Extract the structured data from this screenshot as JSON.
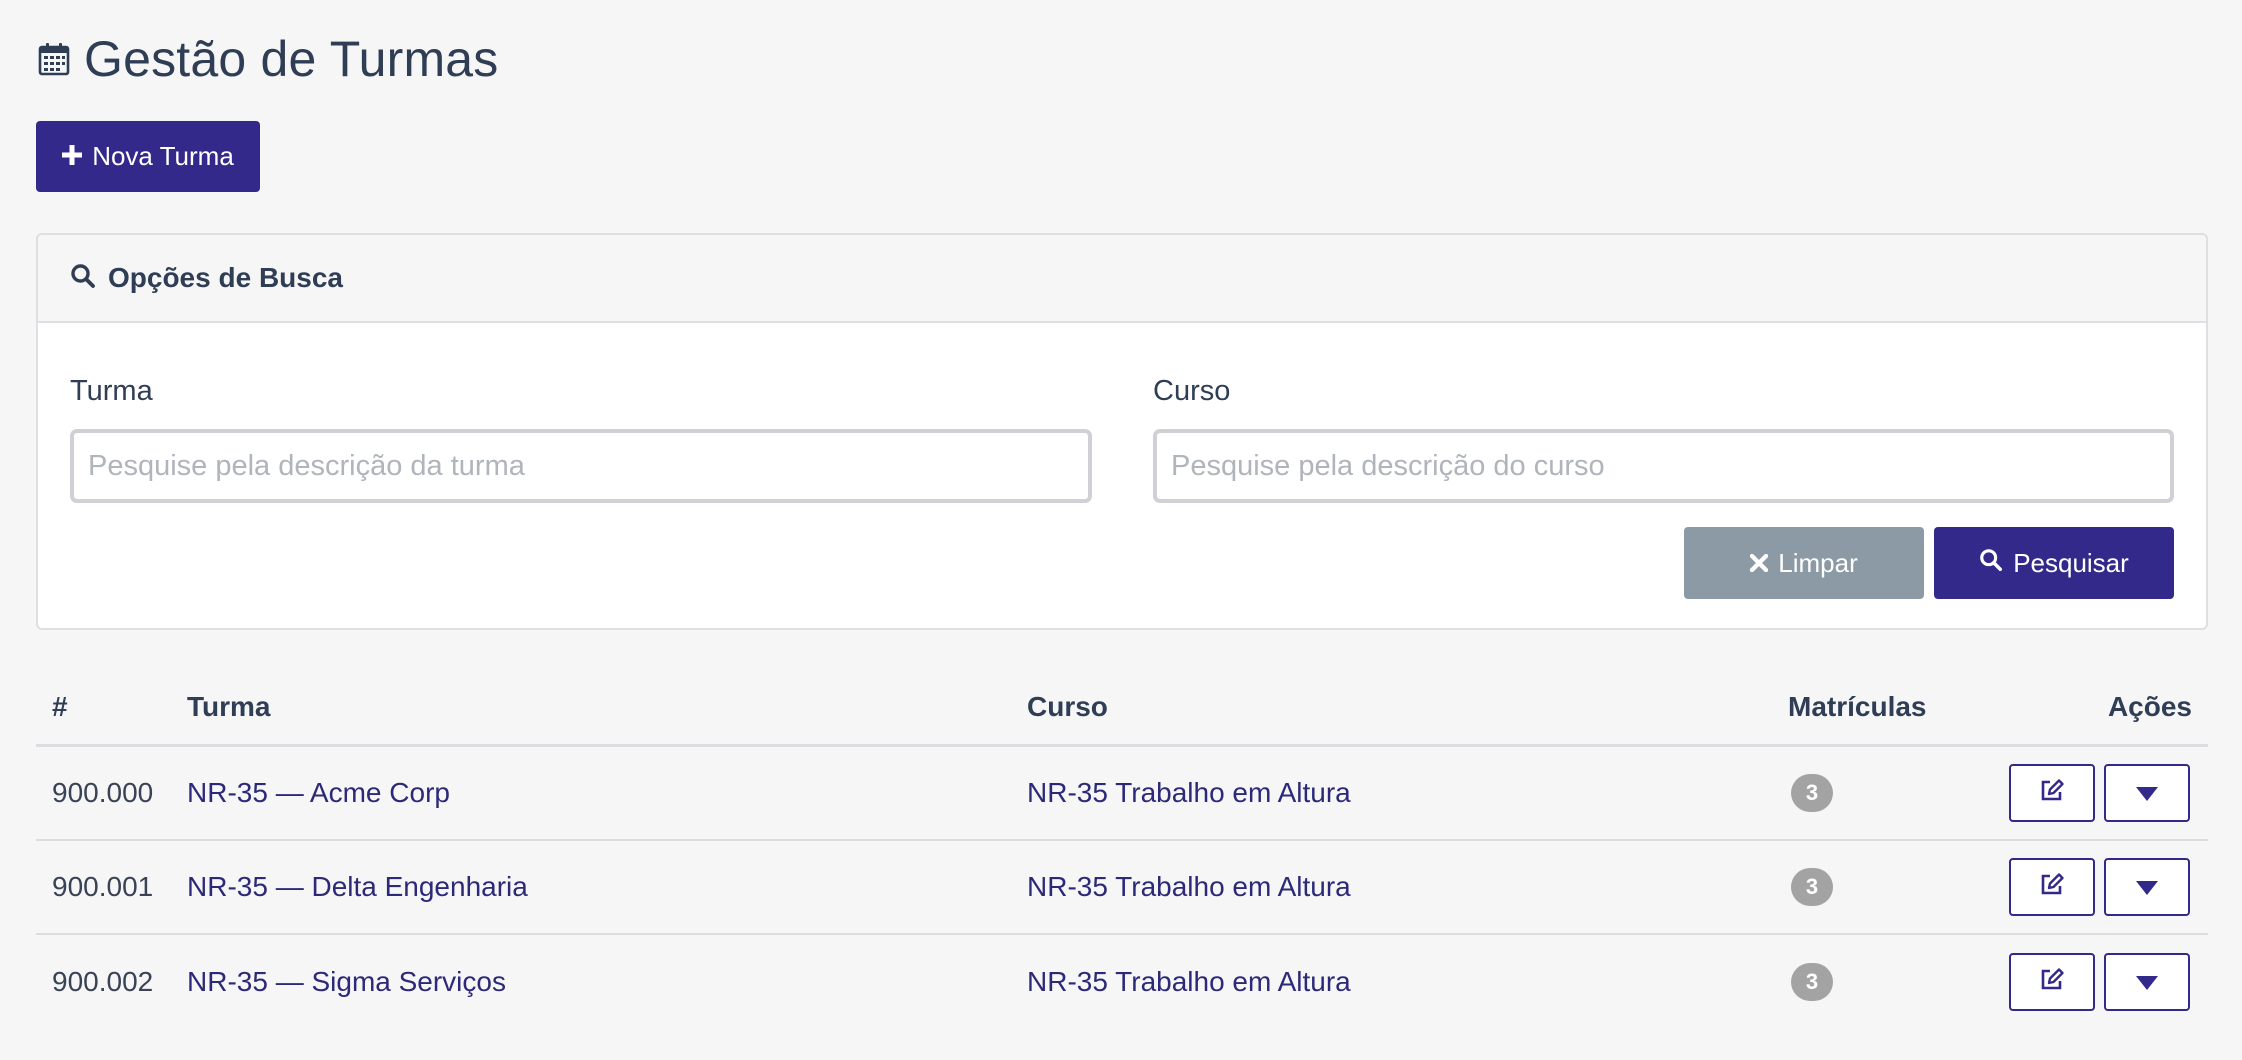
{
  "header": {
    "title": "Gestão de Turmas",
    "title_icon": "calendar-icon"
  },
  "actions": {
    "new_button_label": "Nova Turma",
    "new_button_icon": "plus-icon"
  },
  "search": {
    "header_title": "Opções de Busca",
    "header_icon": "search-icon",
    "turma_label": "Turma",
    "turma_placeholder": "Pesquise pela descrição da turma",
    "turma_value": "",
    "curso_label": "Curso",
    "curso_placeholder": "Pesquise pela descrição do curso",
    "curso_value": "",
    "clear_label": "Limpar",
    "clear_icon": "close-icon",
    "search_label": "Pesquisar",
    "search_icon": "search-icon"
  },
  "table": {
    "columns": [
      "#",
      "Turma",
      "Curso",
      "Matrículas",
      "Ações"
    ],
    "rows": [
      {
        "id": "900.000",
        "turma": "NR-35 — Acme Corp",
        "curso": "NR-35 Trabalho em Altura",
        "matriculas": "3"
      },
      {
        "id": "900.001",
        "turma": "NR-35 — Delta Engenharia",
        "curso": "NR-35 Trabalho em Altura",
        "matriculas": "3"
      },
      {
        "id": "900.002",
        "turma": "NR-35 — Sigma Serviços",
        "curso": "NR-35 Trabalho em Altura",
        "matriculas": "3"
      }
    ],
    "row_action_icons": [
      "edit-icon",
      "caret-down-icon"
    ]
  },
  "colors": {
    "primary": "#33298a",
    "secondary": "#8b9aa5",
    "text": "#2f3d55",
    "link": "#2c2a78",
    "badge": "#a3a3a3",
    "background": "#f6f6f7"
  }
}
